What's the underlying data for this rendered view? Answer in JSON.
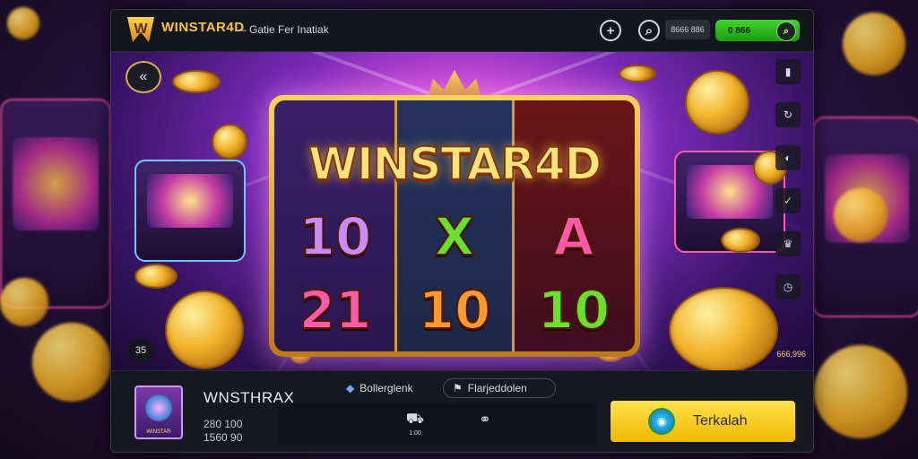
{
  "header": {
    "brand": "WINSTAR4D",
    "brand_sub": "",
    "tagline": "– Gatie Fer Inatiak",
    "add_icon": "plus-icon",
    "search_icon": "search-icon",
    "coins": "8666 886",
    "balance": "0 866",
    "balance_icon": "search-icon"
  },
  "stage": {
    "title": "WINSTAR4D",
    "reels": {
      "top": [
        "10",
        "X",
        "A"
      ],
      "bottom": [
        "21",
        "10",
        "10"
      ]
    },
    "back_icon": "double-chevron-left-icon",
    "control_label": "35",
    "side_icons": [
      "bookmark-icon",
      "refresh-icon",
      "half-circle-icon",
      "shield-check-icon",
      "trophy-icon",
      "clock-icon"
    ],
    "side_value": "666,996"
  },
  "bottom": {
    "thumbnail_label": "WINSTAR",
    "game_name": "WNSTHRAX",
    "stat_1": "280 100",
    "stat_2": "1560 90",
    "tag_1": "Bollerglenk",
    "tag_2": "Flarjeddolen",
    "feature_1_icon": "truck-icon",
    "feature_1_label": "1:00",
    "feature_2_icon": "link-icon",
    "feature_2_label": "",
    "play_label": "Terkalah",
    "play_icon": "globe-icon"
  },
  "colors": {
    "accent_gold": "#f5c542",
    "balance_green": "#3fd52a",
    "play_yellow": "#ffe34a",
    "window_bg": "#14151c"
  }
}
